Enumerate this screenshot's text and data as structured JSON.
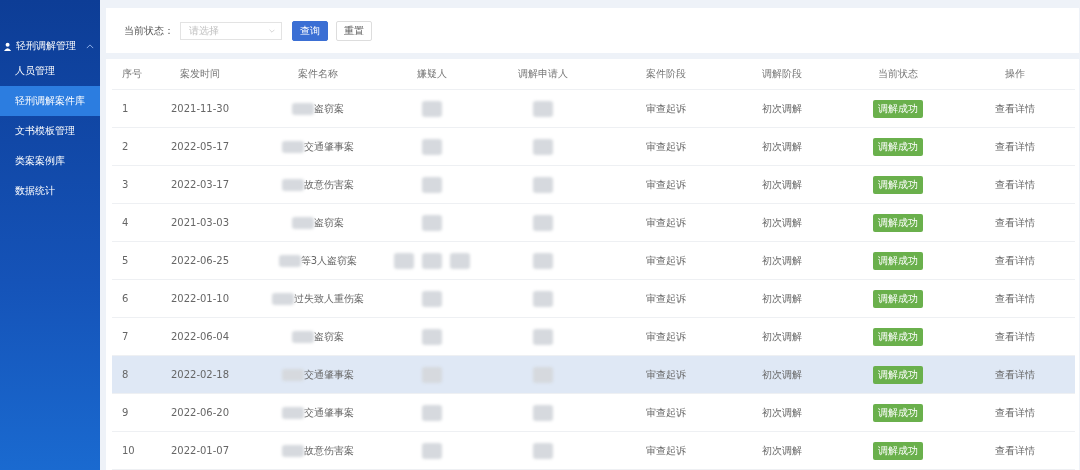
{
  "sidebar": {
    "group": {
      "label": "轻刑调解管理",
      "expanded": true
    },
    "items": [
      {
        "label": "人员管理",
        "selected": false
      },
      {
        "label": "轻刑调解案件库",
        "selected": true
      },
      {
        "label": "文书模板管理",
        "selected": false
      },
      {
        "label": "类案案例库",
        "selected": false
      },
      {
        "label": "数据统计",
        "selected": false
      }
    ]
  },
  "filter": {
    "label": "当前状态：",
    "placeholder": "请选择",
    "buttons": [
      {
        "label": "查询",
        "kind": "primary"
      },
      {
        "label": "重置",
        "kind": "default"
      }
    ]
  },
  "table": {
    "columns": [
      "序号",
      "案发时间",
      "案件名称",
      "嫌疑人",
      "调解申请人",
      "案件阶段",
      "调解阶段",
      "当前状态",
      "操作"
    ],
    "rows": [
      {
        "index": "1",
        "date": "2021-11-30",
        "case_name": "盗窃案",
        "suspect": {
          "kind": "redacted"
        },
        "applicant": {
          "kind": "redacted"
        },
        "case_stage": "审查起诉",
        "mediation_stage": "初次调解",
        "status": "调解成功",
        "action": "查看详情",
        "hovered": false
      },
      {
        "index": "2",
        "date": "2022-05-17",
        "case_name": "交通肇事案",
        "suspect": {
          "kind": "redacted"
        },
        "applicant": {
          "kind": "redacted"
        },
        "case_stage": "审查起诉",
        "mediation_stage": "初次调解",
        "status": "调解成功",
        "action": "查看详情",
        "hovered": false
      },
      {
        "index": "3",
        "date": "2022-03-17",
        "case_name": "故意伤害案",
        "suspect": {
          "kind": "redacted"
        },
        "applicant": {
          "kind": "redacted"
        },
        "case_stage": "审查起诉",
        "mediation_stage": "初次调解",
        "status": "调解成功",
        "action": "查看详情",
        "hovered": false
      },
      {
        "index": "4",
        "date": "2021-03-03",
        "case_name": "盗窃案",
        "suspect": {
          "kind": "redacted"
        },
        "applicant": {
          "kind": "redacted"
        },
        "case_stage": "审查起诉",
        "mediation_stage": "初次调解",
        "status": "调解成功",
        "action": "查看详情",
        "hovered": false
      },
      {
        "index": "5",
        "date": "2022-06-25",
        "case_name": "等3人盗窃案",
        "suspect": {
          "kind": "redacted_group"
        },
        "applicant": {
          "kind": "redacted"
        },
        "case_stage": "审查起诉",
        "mediation_stage": "初次调解",
        "status": "调解成功",
        "action": "查看详情",
        "hovered": false
      },
      {
        "index": "6",
        "date": "2022-01-10",
        "case_name": "过失致人重伤案",
        "suspect": {
          "kind": "redacted"
        },
        "applicant": {
          "kind": "redacted"
        },
        "case_stage": "审查起诉",
        "mediation_stage": "初次调解",
        "status": "调解成功",
        "action": "查看详情",
        "hovered": false
      },
      {
        "index": "7",
        "date": "2022-06-04",
        "case_name": "盗窃案",
        "suspect": {
          "kind": "redacted"
        },
        "applicant": {
          "kind": "redacted"
        },
        "case_stage": "审查起诉",
        "mediation_stage": "初次调解",
        "status": "调解成功",
        "action": "查看详情",
        "hovered": false
      },
      {
        "index": "8",
        "date": "2022-02-18",
        "case_name": "交通肇事案",
        "suspect": {
          "kind": "redacted"
        },
        "applicant": {
          "kind": "redacted"
        },
        "case_stage": "审查起诉",
        "mediation_stage": "初次调解",
        "status": "调解成功",
        "action": "查看详情",
        "hovered": true
      },
      {
        "index": "9",
        "date": "2022-06-20",
        "case_name": "交通肇事案",
        "suspect": {
          "kind": "redacted"
        },
        "applicant": {
          "kind": "redacted"
        },
        "case_stage": "审查起诉",
        "mediation_stage": "初次调解",
        "status": "调解成功",
        "action": "查看详情",
        "hovered": false
      },
      {
        "index": "10",
        "date": "2022-01-07",
        "case_name": "故意伤害案",
        "suspect": {
          "kind": "redacted"
        },
        "applicant": {
          "kind": "redacted"
        },
        "case_stage": "审查起诉",
        "mediation_stage": "初次调解",
        "status": "调解成功",
        "action": "查看详情",
        "hovered": false
      }
    ]
  }
}
